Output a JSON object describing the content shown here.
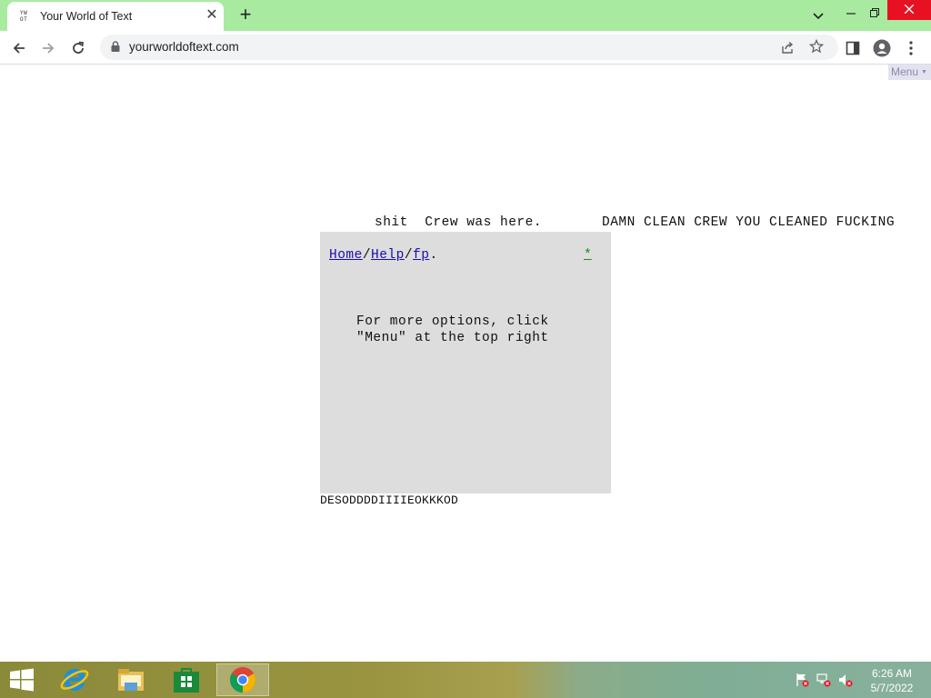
{
  "browser": {
    "tab": {
      "title": "Your World of Text",
      "favicon_text_top": "YW",
      "favicon_text_bottom": "OT"
    },
    "toolbar": {
      "url": "yourworldoftext.com"
    },
    "colors": {
      "tabstrip": "#a8eba0",
      "close_button": "#e81123"
    }
  },
  "page": {
    "menu_label": "Menu",
    "graffiti_line_1": "shit  Crew was here.",
    "graffiti_line_2": "DAMN CLEAN CREW YOU CLEANED FUCKING",
    "graffiti_line_3": "DESODDDDIIIIEOKKKOD",
    "welcome": {
      "nav_home": "Home",
      "nav_help": "Help",
      "nav_fp": "fp",
      "nav_sep": "/",
      "nav_dot": ".",
      "star_link": "*",
      "info_line_1": "For more options, click",
      "info_line_2": "\"Menu\" at the top right"
    }
  },
  "taskbar": {
    "apps": [
      "start-icon",
      "internet-explorer-icon",
      "file-explorer-icon",
      "store-icon",
      "chrome-icon"
    ],
    "clock": {
      "time": "6:26 AM",
      "date": "5/7/2022"
    }
  }
}
